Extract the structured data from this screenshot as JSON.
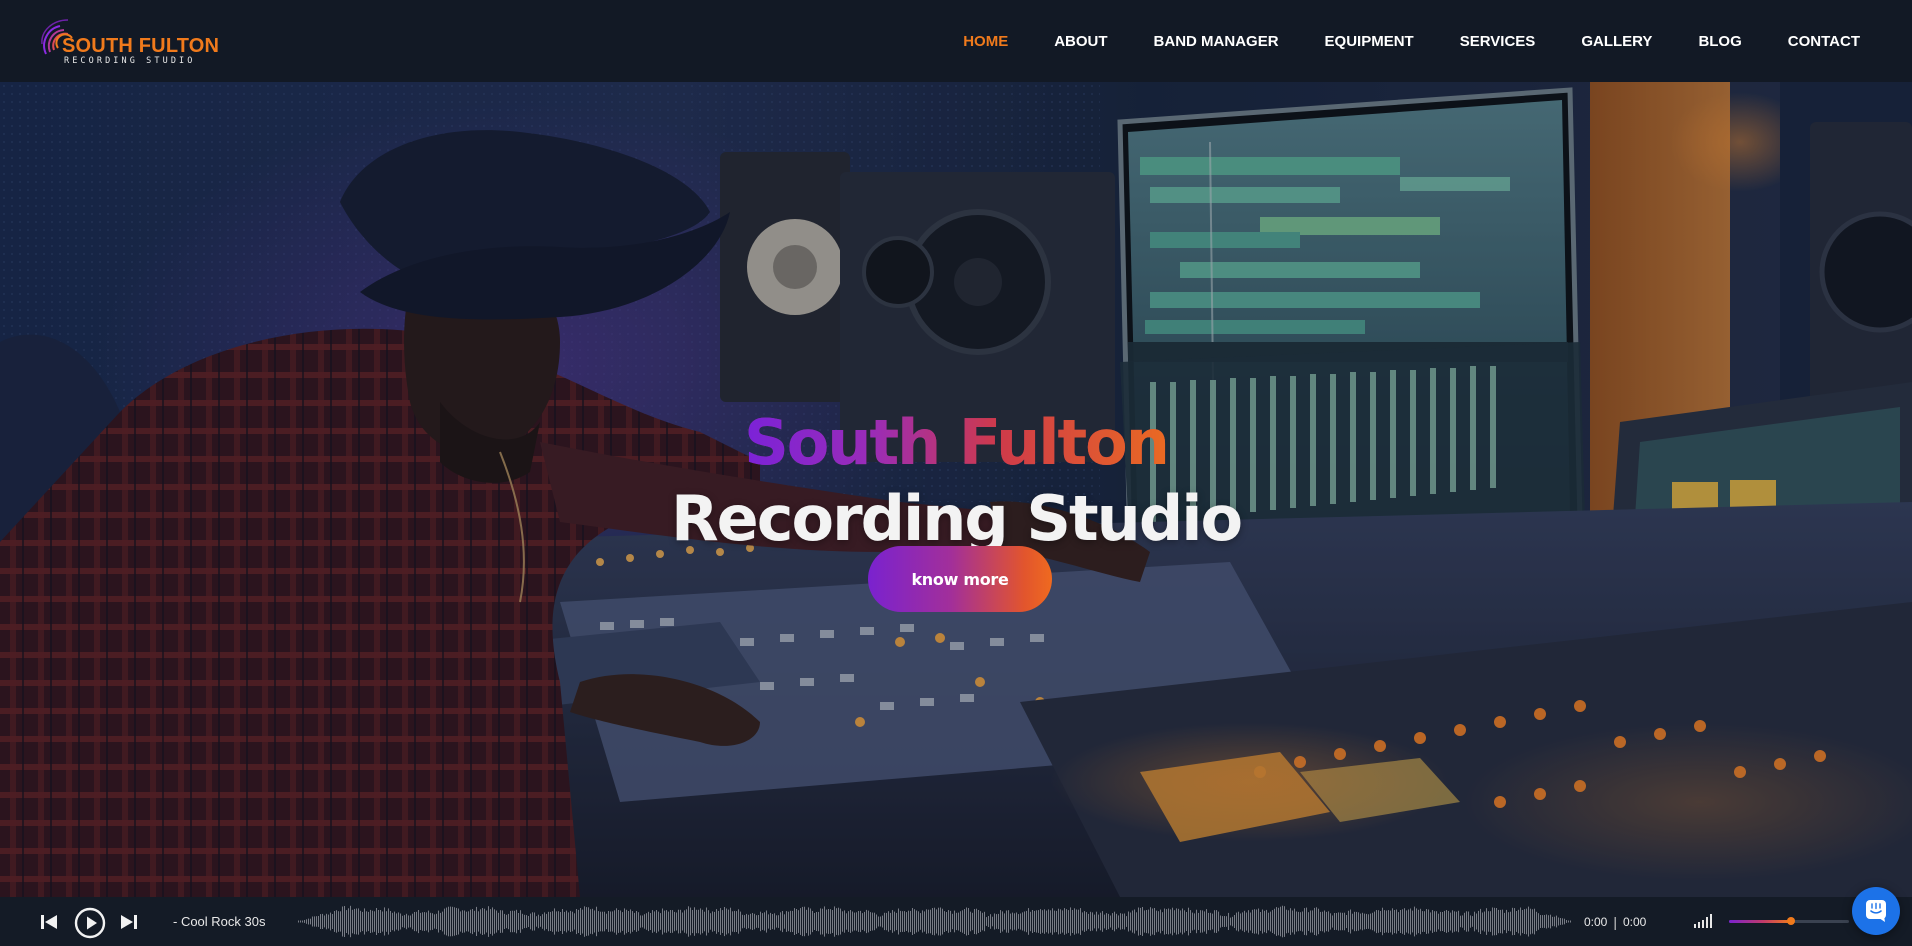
{
  "brand": {
    "name": "SOUTH FULTON",
    "tagline": "RECORDING STUDIO",
    "accent_color": "#f07a1c",
    "gradient_start": "#7a22cf",
    "gradient_end": "#f07a1c"
  },
  "nav": {
    "items": [
      {
        "label": "HOME",
        "active": true
      },
      {
        "label": "ABOUT",
        "active": false
      },
      {
        "label": "BAND MANAGER",
        "active": false
      },
      {
        "label": "EQUIPMENT",
        "active": false
      },
      {
        "label": "SERVICES",
        "active": false
      },
      {
        "label": "GALLERY",
        "active": false
      },
      {
        "label": "BLOG",
        "active": false
      },
      {
        "label": "CONTACT",
        "active": false
      }
    ]
  },
  "hero": {
    "title_line1": "South Fulton",
    "title_line2": "Recording Studio",
    "cta_label": "know more"
  },
  "player": {
    "track_title": "- Cool Rock 30s",
    "current_time": "0:00",
    "separator": "|",
    "duration": "0:00",
    "volume_level": 0.52,
    "icons": [
      "previous-track-icon",
      "play-icon",
      "next-track-icon",
      "volume-bars-icon"
    ]
  },
  "chat": {
    "icon": "chat-bubble-icon",
    "color": "#1c72e8"
  }
}
